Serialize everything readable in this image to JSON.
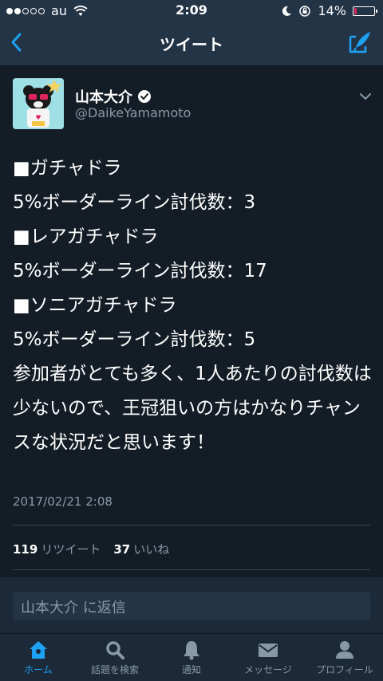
{
  "statusbar": {
    "carrier": "au",
    "time": "2:09",
    "battery_percent": "14%",
    "battery_level": 0.14,
    "signal_bars": 2
  },
  "navbar": {
    "title": "ツイート",
    "back_icon": "chevron-left-icon",
    "compose_icon": "compose-tweet-icon"
  },
  "tweet": {
    "display_name": "山本大介",
    "handle": "@DaikeYamamoto",
    "verified": true,
    "lines": [
      "■ガチャドラ",
      "5%ボーダーライン討伐数：3",
      "■レアガチャドラ",
      "5%ボーダーライン討伐数：17",
      "■ソニアガチャドラ",
      "5%ボーダーライン討伐数：5"
    ],
    "paragraph": "参加者がとても多く、1人あたりの討伐数は少ないので、王冠狙いの方はかなりチャンスな状況だと思います！",
    "timestamp": "2017/02/21 2:08",
    "retweet_count": "119",
    "retweet_label": "リツイート",
    "like_count": "37",
    "like_label": "いいね"
  },
  "reply": {
    "placeholder": "山本大介 に返信"
  },
  "tabs": [
    {
      "label": "ホーム",
      "icon": "home-icon",
      "active": true
    },
    {
      "label": "話題を検索",
      "icon": "search-icon",
      "active": false
    },
    {
      "label": "通知",
      "icon": "bell-icon",
      "active": false
    },
    {
      "label": "メッセージ",
      "icon": "envelope-icon",
      "active": false
    },
    {
      "label": "プロフィール",
      "icon": "person-icon",
      "active": false
    }
  ],
  "colors": {
    "background": "#141d26",
    "bar": "#243447",
    "accent": "#1da1f2",
    "muted": "#8899a6",
    "battery_low": "#e0245e"
  }
}
